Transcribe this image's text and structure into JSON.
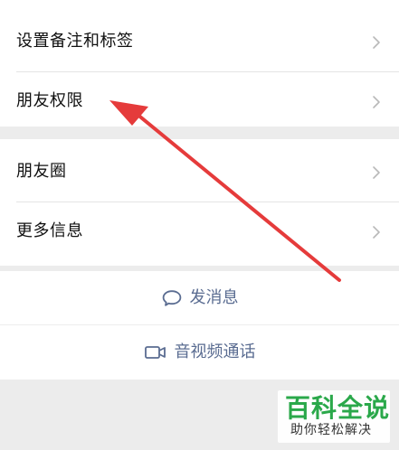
{
  "menu": {
    "group1": [
      {
        "label": "设置备注和标签",
        "chevron": "chevron-right-icon"
      },
      {
        "label": "朋友权限",
        "chevron": "chevron-right-icon"
      }
    ],
    "group2": [
      {
        "label": "朋友圈",
        "chevron": "chevron-right-icon"
      },
      {
        "label": "更多信息",
        "chevron": "chevron-right-icon"
      }
    ]
  },
  "actions": {
    "message": {
      "label": "发消息",
      "icon": "chat-bubble-icon"
    },
    "call": {
      "label": "音视频通话",
      "icon": "video-camera-icon"
    }
  },
  "watermark": {
    "title": "百科全说",
    "subtitle": "助你轻松解决"
  },
  "colors": {
    "background": "#ececec",
    "panel": "#ffffff",
    "text": "#111111",
    "action": "#5a6c91",
    "arrow": "#e53b3b",
    "watermark": "#2aa84a"
  }
}
